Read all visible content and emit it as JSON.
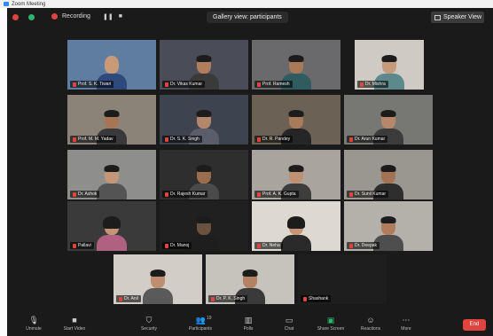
{
  "window": {
    "title": "Zoom Meeting"
  },
  "topbar": {
    "recording_label": "Recording",
    "view_label": "Gallery view: participants",
    "speaker_view_label": "Speaker View"
  },
  "participants": [
    {
      "name": "Prof. S. K. Tiwari",
      "active": true,
      "skin": "#c89a78",
      "room": "#5f7da0",
      "shirt": "#2d4a7a",
      "bald": true
    },
    {
      "name": "Dr. Vikas Kumar",
      "skin": "#b07e5c",
      "room": "#4a4d58",
      "shirt": "#3a3a3a"
    },
    {
      "name": "Prof. Ramesh",
      "skin": "#a87a58",
      "room": "#6a6a6c",
      "shirt": "#2f5c5f"
    },
    {
      "name": "Dr. Mishra",
      "skin": "#c69b7c",
      "room": "#cfcac4",
      "shirt": "#5c8a8c"
    },
    {
      "name": "Prof. M. M. Yadav",
      "skin": "#a67654",
      "room": "#8c8378",
      "shirt": "#39383a"
    },
    {
      "name": "Dr. S. K. Singh",
      "skin": "#b4866a",
      "room": "#3e4350",
      "shirt": "#5b5e6a"
    },
    {
      "name": "Dr. R. Pandey",
      "skin": "#a87c5a",
      "room": "#6b6154",
      "shirt": "#262626"
    },
    {
      "name": "Dr. Arun Kumar",
      "skin": "#b68869",
      "room": "#777773",
      "shirt": "#3c3c3c"
    },
    {
      "name": "Dr. Ashok",
      "skin": "#c29676",
      "room": "#8e8e8c",
      "shirt": "#545454"
    },
    {
      "name": "Dr. Rajesh Kumar",
      "skin": "#9c6c4e",
      "room": "#2e2e2e",
      "shirt": "#4a4a4a"
    },
    {
      "name": "Prof. A. K. Gupta",
      "skin": "#bf9172",
      "room": "#a9a49e",
      "shirt": "#3d3d3d"
    },
    {
      "name": "Dr. Sunil Kumar",
      "skin": "#a37252",
      "room": "#9a9690",
      "shirt": "#2e2e2e"
    },
    {
      "name": "Pallavi",
      "skin": "#c49474",
      "room": "#3a3a3a",
      "shirt": "#b06080",
      "female": true
    },
    {
      "name": "Dr. Manoj",
      "skin": "#6a5240",
      "room": "#202020",
      "shirt": "#1e1e1e"
    },
    {
      "name": "Dr. Neha",
      "skin": "#c59574",
      "room": "#ddd8d0",
      "shirt": "#2a2a2a",
      "female": true
    },
    {
      "name": "Dr. Deepak",
      "skin": "#b07c5c",
      "room": "#b4b0aa",
      "shirt": "#4e4e4e"
    },
    {
      "name": "Dr. Anil",
      "skin": "#bd8f70",
      "room": "#d2cdc6",
      "shirt": "#5a5a5a"
    },
    {
      "name": "Dr. P. K. Singh",
      "skin": "#b28262",
      "room": "#c6c2bc",
      "shirt": "#3a3a3a"
    },
    {
      "name": "Shashank",
      "skin": "#222222",
      "room": "#1e1e1e",
      "shirt": "#1e1e1e",
      "empty": true
    }
  ],
  "toolbar": {
    "items": [
      {
        "label": "Unmute",
        "icon": "microphone-icon"
      },
      {
        "label": "Start Video",
        "icon": "camera-icon"
      },
      {
        "label": "Security",
        "icon": "shield-icon"
      },
      {
        "label": "Participants",
        "icon": "participants-icon",
        "count": "19"
      },
      {
        "label": "Polls",
        "icon": "poll-icon"
      },
      {
        "label": "Chat",
        "icon": "chat-icon"
      },
      {
        "label": "Share Screen",
        "icon": "share-screen-icon"
      },
      {
        "label": "Reactions",
        "icon": "smiley-icon"
      },
      {
        "label": "More",
        "icon": "more-icon"
      }
    ],
    "end_label": "End"
  }
}
